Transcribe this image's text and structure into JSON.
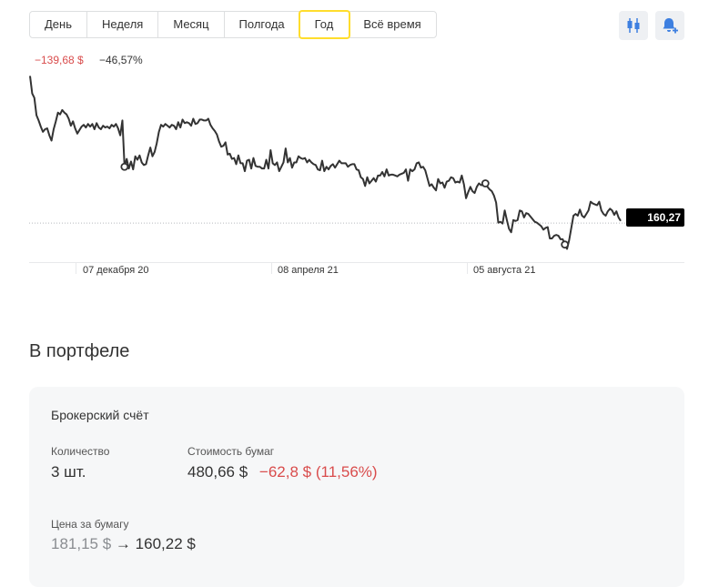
{
  "periods": {
    "items": [
      "День",
      "Неделя",
      "Месяц",
      "Полгода",
      "Год",
      "Всё время"
    ],
    "active": "Год"
  },
  "toolbar": {
    "candles_icon": "candlestick-chart-icon",
    "alert_icon": "bell-add-icon",
    "icon_color": "#3d7fe0"
  },
  "change": {
    "absolute": "−139,68 $",
    "percent": "−46,57%"
  },
  "price_label": "160,27",
  "chart_data": {
    "type": "line",
    "x_ticks": [
      "07 декабря 20",
      "08 апреля 21",
      "05 августа 21"
    ],
    "series": [
      {
        "values": [
          167.0,
          165.0,
          164.5,
          162.5,
          161.9,
          161.2,
          160.6,
          160.9,
          161.0,
          160.2,
          159.6,
          160.9,
          161.8,
          162.8,
          162.6,
          163.1,
          162.8,
          162.6,
          162.1,
          161.3,
          161.8,
          161.0,
          160.4,
          160.8,
          161.2,
          161.4,
          161.1,
          161.5,
          161.2,
          161.5,
          160.9,
          161.6,
          161.1,
          160.9,
          161.3,
          161.1,
          161.2,
          161.0,
          161.4,
          161.2,
          161.5,
          161.0,
          160.2,
          161.9,
          156.6,
          157.5,
          156.4,
          157.2,
          156.3,
          157.8,
          157.4,
          157.9,
          157.1,
          156.8,
          156.9,
          157.9,
          158.8,
          157.8,
          158.3,
          159.3,
          160.6,
          161.4,
          161.2,
          161.5,
          161.3,
          161.1,
          161.4,
          161.3,
          160.9,
          161.7,
          161.1,
          162.0,
          161.6,
          161.7,
          161.6,
          161.3,
          162.1,
          161.5,
          161.6,
          162.0,
          162.0,
          161.9,
          161.9,
          162.1,
          161.4,
          161.0,
          160.7,
          160.3,
          159.5,
          158.9,
          159.0,
          159.4,
          158.0,
          158.1,
          157.5,
          157.6,
          156.9,
          157.9,
          157.0,
          157.0,
          156.1,
          157.3,
          157.4,
          156.4,
          157.6,
          156.7,
          156.6,
          156.6,
          156.4,
          156.4,
          157.4,
          156.4,
          158.5,
          157.0,
          156.8,
          157.1,
          156.1,
          156.6,
          157.1,
          158.7,
          157.1,
          157.6,
          156.5,
          157.1,
          157.1,
          157.8,
          157.6,
          157.5,
          157.6,
          157.1,
          157.4,
          157.1,
          156.9,
          156.8,
          156.3,
          156.2,
          157.3,
          156.1,
          156.6,
          156.3,
          156.7,
          156.9,
          156.5,
          156.9,
          157.3,
          157.0,
          157.0,
          157.0,
          156.6,
          156.8,
          156.9,
          156.9,
          156.3,
          156.2,
          155.4,
          155.2,
          154.4,
          155.4,
          154.7,
          155.0,
          155.3,
          154.9,
          155.6,
          155.6,
          156.0,
          155.5,
          156.3,
          155.6,
          155.7,
          155.7,
          155.6,
          155.5,
          155.7,
          155.8,
          155.9,
          156.3,
          155.0,
          156.3,
          156.1,
          156.3,
          157.0,
          157.1,
          156.5,
          156.6,
          156.2,
          155.3,
          154.4,
          154.6,
          154.2,
          153.9,
          155.2,
          154.7,
          154.8,
          154.2,
          154.9,
          155.0,
          155.4,
          155.3,
          154.8,
          154.9,
          154.8,
          155.6,
          154.6,
          153.0,
          153.7,
          154.3,
          153.8,
          153.6,
          154.3,
          154.7,
          154.5,
          154.5,
          154.7,
          154.3,
          154.0,
          153.8,
          153.3,
          152.5,
          150.2,
          150.3,
          150.1,
          151.6,
          150.5,
          149.5,
          149.1,
          150.5,
          150.4,
          150.5,
          151.6,
          151.5,
          150.8,
          151.3,
          151.2,
          150.9,
          150.6,
          150.3,
          150.2,
          150.0,
          149.8,
          149.4,
          149.6,
          149.7,
          148.4,
          148.4,
          148.7,
          148.8,
          148.7,
          148.3,
          148.3,
          147.7,
          147.2,
          148.2,
          149.6,
          151.0,
          151.2,
          151.0,
          151.7,
          151.0,
          150.8,
          151.2,
          151.6,
          152.6,
          152.4,
          152.3,
          152.2,
          152.6,
          151.6,
          151.2,
          151.0,
          151.5,
          151.8,
          151.6,
          151.1,
          151.5,
          150.8,
          150.4
        ]
      }
    ],
    "markers_at_index": [
      44,
      212,
      249
    ],
    "reference_line": 150.15,
    "ylim": [
      146.0,
      168.4
    ]
  },
  "portfolio": {
    "title": "В портфеле",
    "account": "Брокерский счёт",
    "quantity_label": "Количество",
    "quantity_value": "3 шт.",
    "cost_label": "Стоимость бумаг",
    "cost_value": "480,66 $",
    "cost_change": "−62,8 $ (11,56%)",
    "price_label": "Цена за бумагу",
    "price_from": "181,15 $",
    "price_arrow": "→",
    "price_to": "160,22 $"
  },
  "colors": {
    "negative": "#d94c4c",
    "accent": "#ffdd2d",
    "muted": "#8a8d91"
  }
}
